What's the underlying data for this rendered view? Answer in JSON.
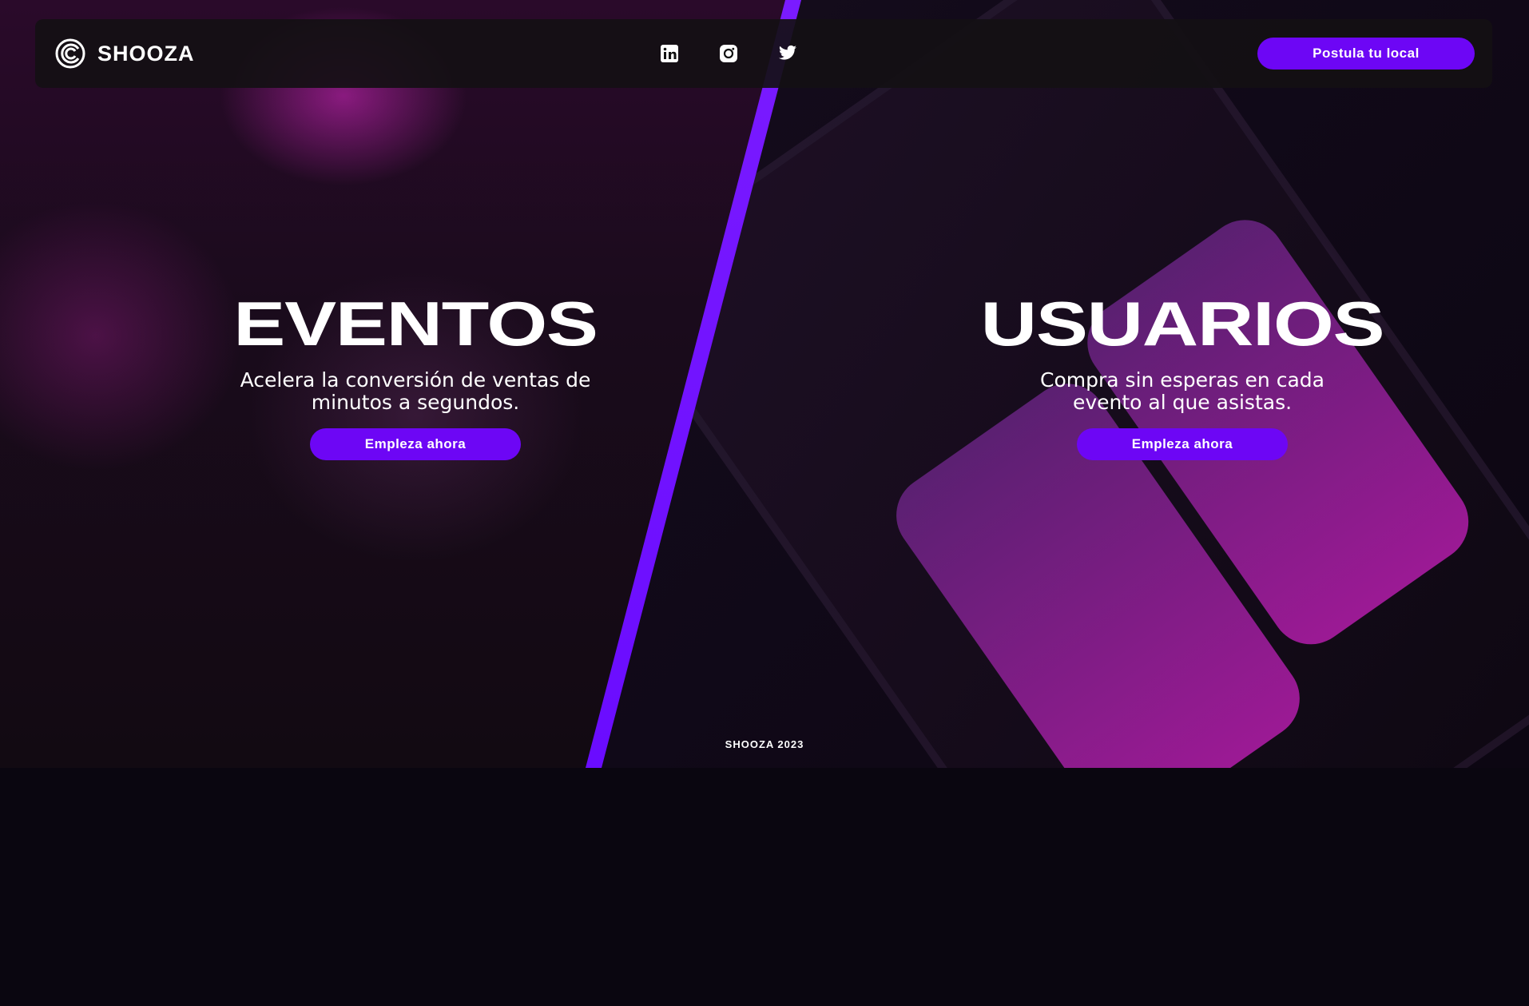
{
  "brand": {
    "name": "SHOOZA",
    "accent": "#6d06f5"
  },
  "nav": {
    "social_icons": [
      "linkedin-icon",
      "instagram-icon",
      "twitter-icon"
    ],
    "cta_label": "Postula tu local"
  },
  "events": {
    "title": "EVENTOS",
    "description_line1": "Acelera la conversión de ventas de",
    "description_line2": "minutos a segundos.",
    "button_label": "Empleza ahora"
  },
  "users": {
    "title": "USUARIOS",
    "description_line1": "Compra sin esperas en cada",
    "description_line2": "evento al que asistas.",
    "button_label": "Empleza ahora"
  },
  "footer": {
    "text": "SHOOZA 2023"
  }
}
